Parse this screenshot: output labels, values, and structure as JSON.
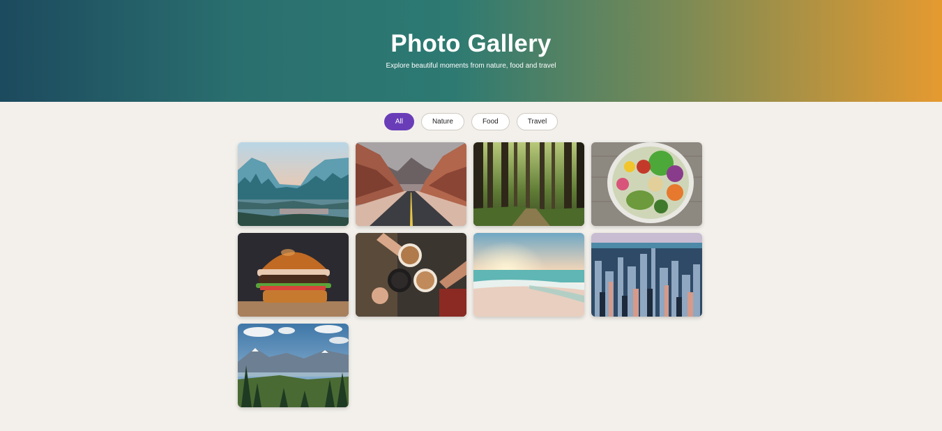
{
  "header": {
    "title": "Photo Gallery",
    "subtitle": "Explore beautiful moments from nature, food and travel"
  },
  "filters": [
    {
      "label": "All",
      "active": true
    },
    {
      "label": "Nature",
      "active": false
    },
    {
      "label": "Food",
      "active": false
    },
    {
      "label": "Travel",
      "active": false
    }
  ],
  "colors": {
    "accent": "#6a3db8",
    "background": "#f3f0eb",
    "gradient_start": "#1c4a5e",
    "gradient_end": "#e59a30"
  }
}
